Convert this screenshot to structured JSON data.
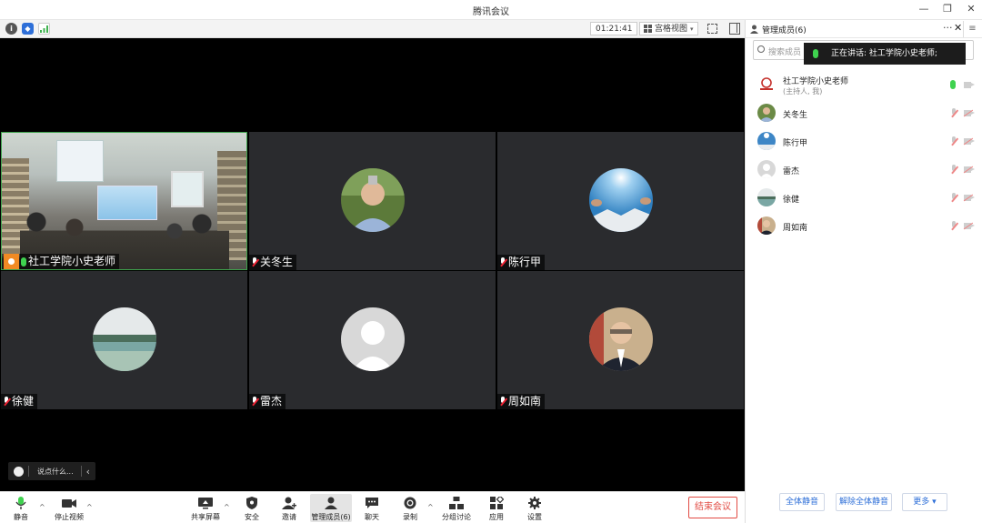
{
  "window": {
    "title": "腾讯会议",
    "controls": {
      "minimize": "—",
      "restore": "❐",
      "close": "✕"
    }
  },
  "video_toolbar": {
    "icons": [
      "info-icon",
      "shield-icon",
      "signal-icon"
    ],
    "timer": "01:21:41",
    "view_mode": "宫格视图",
    "view_caret": "▾"
  },
  "tiles": [
    {
      "name": "社工学院小史老师",
      "mic": "on",
      "host": true,
      "kind": "camera"
    },
    {
      "name": "关冬生",
      "mic": "muted",
      "kind": "avatar"
    },
    {
      "name": "陈行甲",
      "mic": "muted",
      "kind": "avatar"
    },
    {
      "name": "徐健",
      "mic": "muted",
      "kind": "avatar"
    },
    {
      "name": "雷杰",
      "mic": "muted",
      "kind": "avatar"
    },
    {
      "name": "周如南",
      "mic": "muted",
      "kind": "avatar"
    }
  ],
  "chat": {
    "placeholder": "说点什么...",
    "collapse": "‹"
  },
  "bottom_toolbar": {
    "mute": "静音",
    "stop_video": "停止视频",
    "share_screen": "共享屏幕",
    "security": "安全",
    "invite": "邀请",
    "manage_members": "管理成员(6)",
    "chat": "聊天",
    "record": "录制",
    "breakout": "分组讨论",
    "apps": "应用",
    "settings": "设置",
    "end_meeting": "结束会议",
    "caret": "^"
  },
  "panel": {
    "title": "管理成员(6)",
    "more": "···",
    "close": "✕",
    "menu": "≡",
    "search_placeholder": "搜索成员",
    "speaking": "正在讲话: 社工学院小史老师;",
    "participants": [
      {
        "name": "社工学院小史老师",
        "sub": "(主持人, 我)",
        "mic": "on"
      },
      {
        "name": "关冬生",
        "mic": "off"
      },
      {
        "name": "陈行甲",
        "mic": "off"
      },
      {
        "name": "雷杰",
        "mic": "off"
      },
      {
        "name": "徐健",
        "mic": "off"
      },
      {
        "name": "周如南",
        "mic": "off"
      }
    ],
    "buttons": {
      "mute_all": "全体静音",
      "unmute_all": "解除全体静音",
      "more": "更多 ▾"
    }
  },
  "colors": {
    "accent_blue": "#2e6fd8",
    "end_red": "#e24b43",
    "mic_green": "#3fd24f",
    "host_orange": "#f08a24"
  }
}
